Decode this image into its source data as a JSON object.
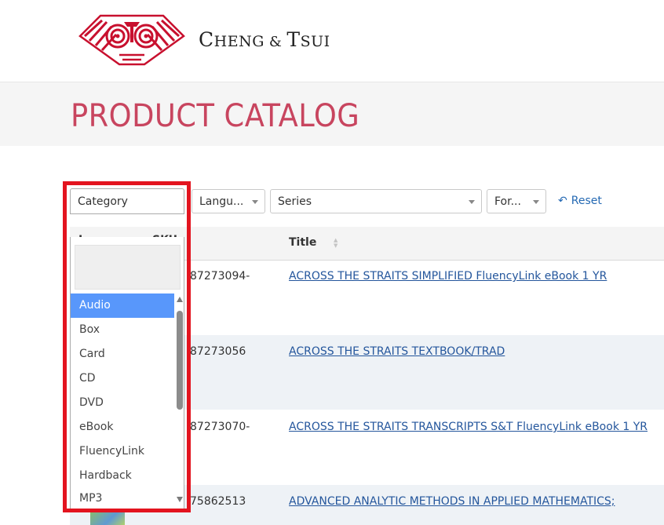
{
  "header": {
    "brand": {
      "c": "C",
      "heng": "HENG",
      "amp": "&",
      "t": "T",
      "sui": "SUI"
    }
  },
  "page": {
    "title": "PRODUCT CATALOG"
  },
  "filters": {
    "category": "Category",
    "language": "Langu...",
    "series": "Series",
    "format": "For...",
    "reset": "Reset"
  },
  "table": {
    "headers": {
      "image": "Image",
      "sku": "SKU",
      "title": "Title"
    },
    "rows": [
      {
        "sku": "87273094-",
        "title": "ACROSS THE STRAITS SIMPLIFIED FluencyLink eBook 1 YR"
      },
      {
        "sku": "87273056",
        "title": "ACROSS THE STRAITS TEXTBOOK/TRAD"
      },
      {
        "sku": "87273070-",
        "title": "ACROSS THE STRAITS TRANSCRIPTS S&T FluencyLink eBook 1 YR"
      },
      {
        "sku": "75862513",
        "title": "ADVANCED ANALYTIC METHODS IN APPLIED MATHEMATICS;"
      }
    ]
  },
  "category_dropdown": {
    "options": [
      "Audio",
      "Box",
      "Card",
      "CD",
      "DVD",
      "eBook",
      "FluencyLink",
      "Hardback",
      "MP3"
    ],
    "highlighted": "Audio"
  },
  "colors": {
    "title": "#c8455f",
    "link": "#24569c",
    "highlight_box": "#e3141f",
    "option_active": "#5897fb",
    "logo": "#c8102e"
  }
}
